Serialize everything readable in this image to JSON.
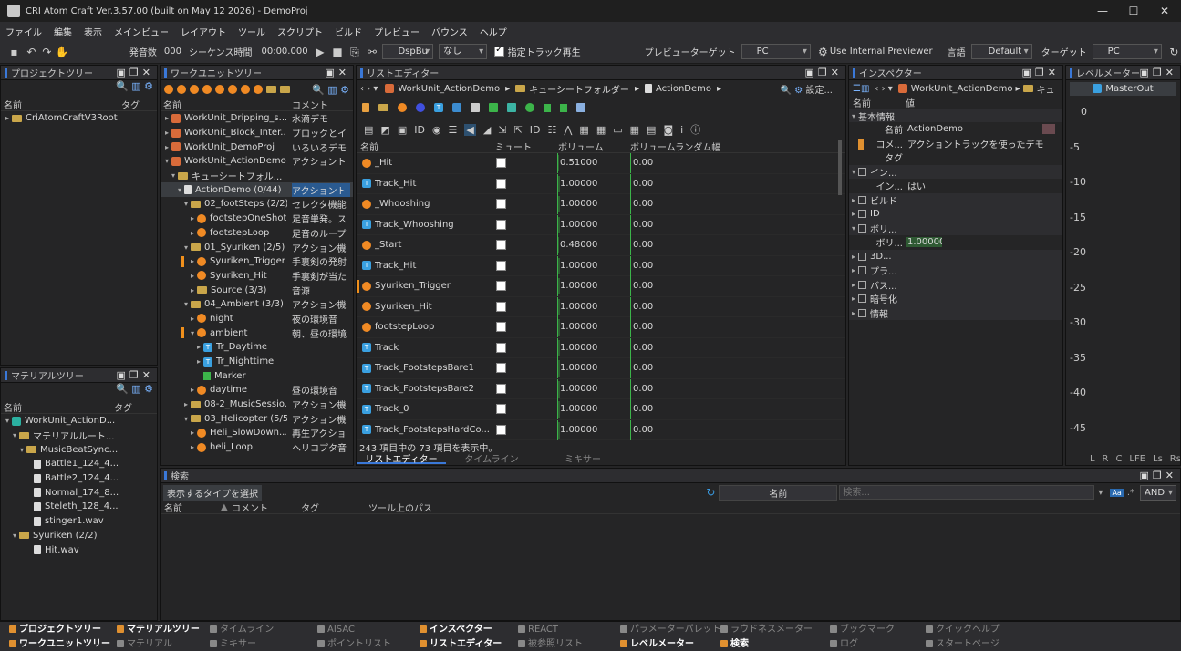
{
  "window": {
    "title": "CRI Atom Craft Ver.3.57.00 (built on May 12 2026) - DemoProj",
    "min": "—",
    "max": "☐",
    "close": "✕"
  },
  "menu": [
    "ファイル",
    "編集",
    "表示",
    "メインビュー",
    "レイアウト",
    "ツール",
    "スクリプト",
    "ビルド",
    "プレビュー",
    "バウンス",
    "ヘルプ"
  ],
  "toolbar": {
    "voices_label": "発音数",
    "voices_value": "000",
    "seq_time_label": "シーケンス時間",
    "seq_time_value": "00:00.000",
    "dsp_combo": "DspBu",
    "none_combo": "なし",
    "play_track_label": "指定トラック再生",
    "preview_target_label": "プレビューターゲット",
    "preview_target": "PC",
    "internal_previewer": "Use Internal Previewer",
    "language_label": "言語",
    "language_value": "Default",
    "target_label": "ターゲット",
    "target_value": "PC"
  },
  "project_tree": {
    "title": "プロジェクトツリー",
    "col_name": "名前",
    "col_tag": "タグ",
    "items": [
      "CriAtomCraftV3Root"
    ]
  },
  "material_tree": {
    "title": "マテリアルツリー",
    "col_name": "名前",
    "col_tag": "タグ",
    "items": [
      "WorkUnit_ActionD...",
      "マテリアルルート...",
      "MusicBeatSync...",
      "Battle1_124_4...",
      "Battle2_124_4...",
      "Normal_174_8...",
      "Steleth_128_4...",
      "stinger1.wav",
      "Syuriken (2/2)",
      "Hit.wav"
    ]
  },
  "workunit_tree": {
    "title": "ワークユニットツリー",
    "col_name": "名前",
    "col_comment": "コメント",
    "items": [
      {
        "name": "WorkUnit_Dripping_s...",
        "comment": "水滴デモ"
      },
      {
        "name": "WorkUnit_Block_Inter...",
        "comment": "ブロックとイ"
      },
      {
        "name": "WorkUnit_DemoProj",
        "comment": "いろいろデモ"
      },
      {
        "name": "WorkUnit_ActionDemo",
        "comment": "アクショント"
      },
      {
        "name": "キューシートフォル...",
        "comment": ""
      },
      {
        "name": "ActionDemo (0/44)",
        "comment": "アクショント"
      },
      {
        "name": "02_footSteps (2/2)",
        "comment": "セレクタ機能"
      },
      {
        "name": "footstepOneShot",
        "comment": "足音単発。ス"
      },
      {
        "name": "footstepLoop",
        "comment": "足音のループ"
      },
      {
        "name": "01_Syuriken (2/5)",
        "comment": "アクション機"
      },
      {
        "name": "Syuriken_Trigger",
        "comment": "手裏剣の発射"
      },
      {
        "name": "Syuriken_Hit",
        "comment": "手裏剣が当た"
      },
      {
        "name": "Source (3/3)",
        "comment": "音源"
      },
      {
        "name": "04_Ambient (3/3)",
        "comment": "アクション機"
      },
      {
        "name": "night",
        "comment": "夜の環境音"
      },
      {
        "name": "ambient",
        "comment": "朝、昼の環境"
      },
      {
        "name": "Tr_Daytime",
        "comment": ""
      },
      {
        "name": "Tr_Nighttime",
        "comment": ""
      },
      {
        "name": "Marker",
        "comment": ""
      },
      {
        "name": "daytime",
        "comment": "昼の環境音"
      },
      {
        "name": "08-2_MusicSessio...",
        "comment": "アクション機"
      },
      {
        "name": "03_Helicopter (5/5)",
        "comment": "アクション機"
      },
      {
        "name": "Heli_SlowDown...",
        "comment": "再生アクショ"
      },
      {
        "name": "heli_Loop",
        "comment": "ヘリコプタ音"
      }
    ]
  },
  "list_editor": {
    "title": "リストエディター",
    "breadcrumb": [
      "WorkUnit_ActionDemo",
      "キューシートフォルダー",
      "ActionDemo"
    ],
    "settings": "設定...",
    "col_name": "名前",
    "col_mute": "ミュート",
    "col_volume": "ボリューム",
    "col_volrand": "ボリュームランダム幅",
    "rows": [
      {
        "name": "_Hit",
        "type": "cue",
        "volume": "0.51000",
        "vol": 0.51,
        "rand": "0.00"
      },
      {
        "name": "Track_Hit",
        "type": "track",
        "volume": "1.00000",
        "vol": 1,
        "rand": "0.00"
      },
      {
        "name": "_Whooshing",
        "type": "cue",
        "volume": "1.00000",
        "vol": 1,
        "rand": "0.00"
      },
      {
        "name": "Track_Whooshing",
        "type": "track",
        "volume": "1.00000",
        "vol": 1,
        "rand": "0.00"
      },
      {
        "name": "_Start",
        "type": "cue",
        "volume": "0.48000",
        "vol": 0.48,
        "rand": "0.00"
      },
      {
        "name": "Track_Hit",
        "type": "track",
        "volume": "1.00000",
        "vol": 1,
        "rand": "0.00"
      },
      {
        "name": "Syuriken_Trigger",
        "type": "cue",
        "volume": "1.00000",
        "vol": 1,
        "rand": "0.00"
      },
      {
        "name": "Syuriken_Hit",
        "type": "cue",
        "volume": "1.00000",
        "vol": 1,
        "rand": "0.00"
      },
      {
        "name": "footstepLoop",
        "type": "cue",
        "volume": "1.00000",
        "vol": 1,
        "rand": "0.00"
      },
      {
        "name": "Track",
        "type": "track",
        "volume": "1.00000",
        "vol": 1,
        "rand": "0.00"
      },
      {
        "name": "Track_FootstepsBare1",
        "type": "track",
        "volume": "1.00000",
        "vol": 1,
        "rand": "0.00"
      },
      {
        "name": "Track_FootstepsBare2",
        "type": "track",
        "volume": "1.00000",
        "vol": 1,
        "rand": "0.00"
      },
      {
        "name": "Track_0",
        "type": "track",
        "volume": "1.00000",
        "vol": 1,
        "rand": "0.00"
      },
      {
        "name": "Track_FootstepsHardCo...",
        "type": "track",
        "volume": "1.00000",
        "vol": 1,
        "rand": "0.00"
      }
    ],
    "status": "243 項目中の 73 項目を表示中。",
    "tabs": [
      "リストエディター",
      "タイムライン",
      "ミキサー"
    ]
  },
  "inspector": {
    "title": "インスペクター",
    "path": [
      "WorkUnit_ActionDemo",
      "キュ"
    ],
    "col_name": "名前",
    "col_value": "値",
    "rows": [
      {
        "name": "基本情報",
        "value": "",
        "level": 0,
        "open": true
      },
      {
        "name": "名前",
        "value": "ActionDemo",
        "level": 2
      },
      {
        "name": "コメ...",
        "value": "アクショントラックを使ったデモ",
        "level": 2
      },
      {
        "name": "タグ",
        "value": "",
        "level": 2
      },
      {
        "name": "イン...",
        "value": "",
        "level": 0,
        "open": true
      },
      {
        "name": "イン...",
        "value": "はい",
        "level": 2
      },
      {
        "name": "ビルド",
        "value": "",
        "level": 0
      },
      {
        "name": "ID",
        "value": "",
        "level": 0
      },
      {
        "name": "ボリ...",
        "value": "",
        "level": 0,
        "open": true
      },
      {
        "name": "ボリ...",
        "value": "1.00000",
        "level": 2
      },
      {
        "name": "3D...",
        "value": "",
        "level": 0
      },
      {
        "name": "プラ...",
        "value": "",
        "level": 0
      },
      {
        "name": "バス...",
        "value": "",
        "level": 0
      },
      {
        "name": "暗号化",
        "value": "",
        "level": 0
      },
      {
        "name": "情報",
        "value": "",
        "level": 0
      }
    ]
  },
  "level_meter": {
    "title": "レベルメーター",
    "bus": "MasterOut",
    "ticks": [
      "0",
      "-5",
      "-10",
      "-15",
      "-20",
      "-25",
      "-30",
      "-35",
      "-40",
      "-45"
    ],
    "channels": [
      "L",
      "R",
      "C",
      "LFE",
      "Ls",
      "Rs"
    ]
  },
  "search": {
    "title": "検索",
    "type_button": "表示するタイプを選択",
    "field": "名前",
    "placeholder": "検索...",
    "logic": "AND",
    "col_name": "名前",
    "col_comment": "コメント",
    "col_tag": "タグ",
    "col_path": "ツール上のパス"
  },
  "taskbar": [
    [
      "プロジェクトツリー",
      true
    ],
    [
      "ワークユニットツリー",
      true
    ],
    [
      "マテリアルツリー",
      true
    ],
    [
      "マテリアル",
      false
    ],
    [
      "タイムライン",
      false
    ],
    [
      "ミキサー",
      false
    ],
    [
      "AISAC",
      false
    ],
    [
      "ポイントリスト",
      false
    ],
    [
      "インスペクター",
      true
    ],
    [
      "リストエディター",
      true
    ],
    [
      "REACT",
      false
    ],
    [
      "被参照リスト",
      false
    ],
    [
      "パラメーターパレット",
      false
    ],
    [
      "レベルメーター",
      true
    ],
    [
      "ラウドネスメーター",
      false
    ],
    [
      "検索",
      true
    ],
    [
      "ブックマーク",
      false
    ],
    [
      "ログ",
      false
    ],
    [
      "クイックヘルプ",
      false
    ],
    [
      "スタートページ",
      false
    ]
  ]
}
